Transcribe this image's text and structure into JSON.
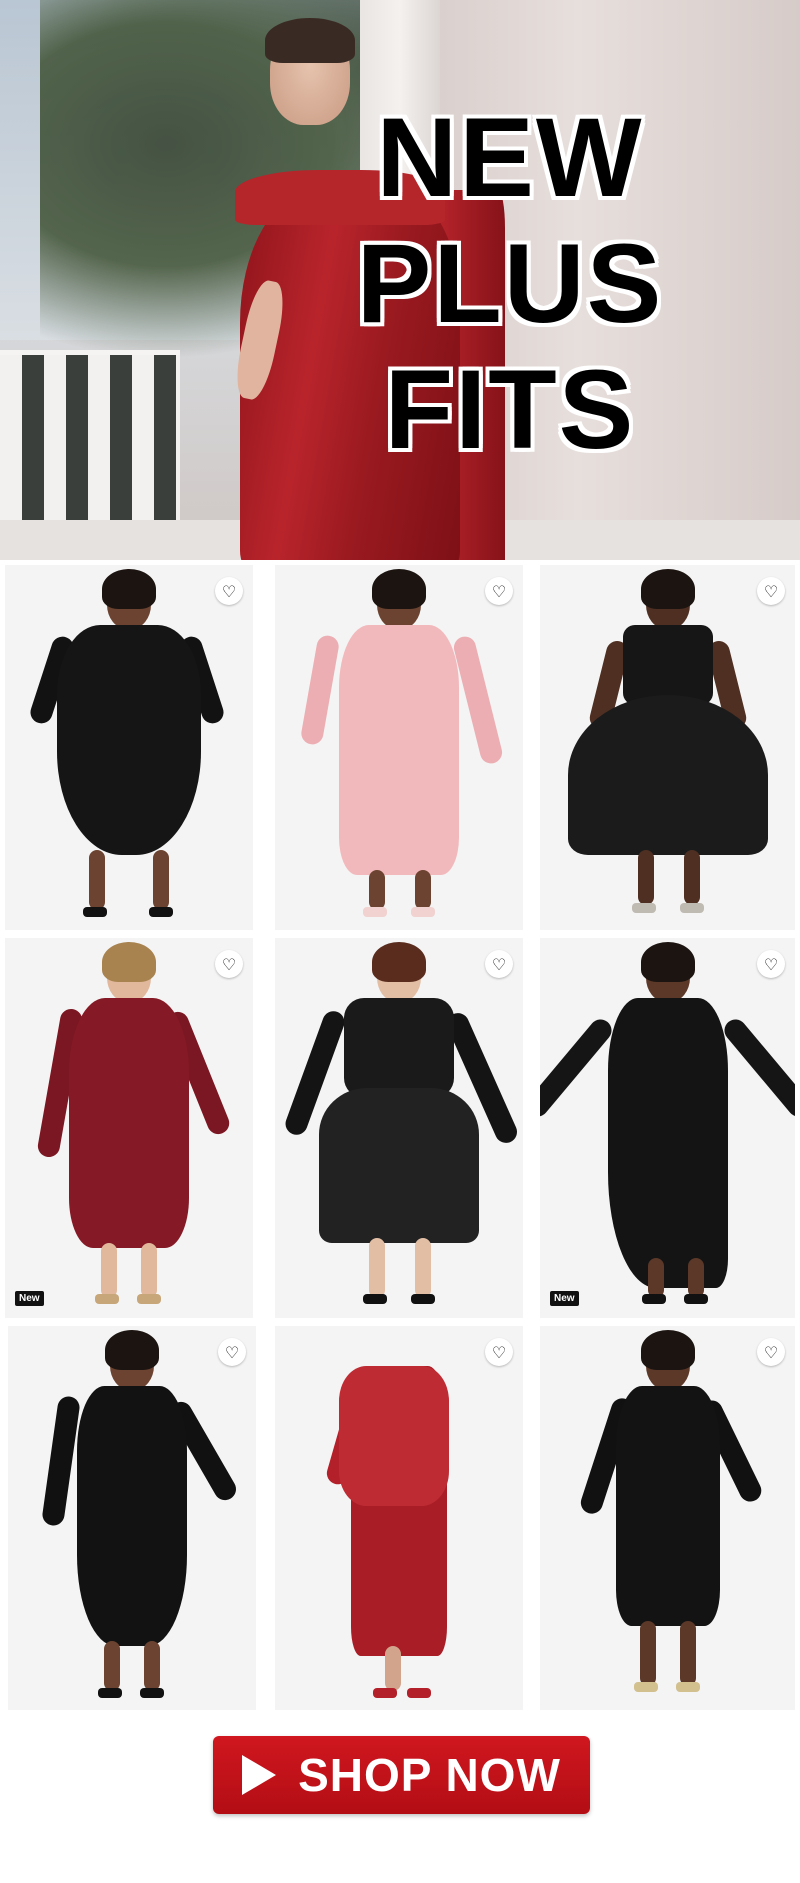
{
  "hero": {
    "headline": [
      "NEW",
      "PLUS",
      "FITS"
    ]
  },
  "products": [
    {
      "new_badge": "",
      "favorite_icon": "heart-outline-icon"
    },
    {
      "new_badge": "",
      "favorite_icon": "heart-outline-icon"
    },
    {
      "new_badge": "",
      "favorite_icon": "heart-outline-icon"
    },
    {
      "new_badge": "New",
      "favorite_icon": "heart-outline-icon"
    },
    {
      "new_badge": "",
      "favorite_icon": "heart-outline-icon"
    },
    {
      "new_badge": "New",
      "favorite_icon": "heart-outline-icon"
    },
    {
      "new_badge": "",
      "favorite_icon": "heart-outline-icon"
    },
    {
      "new_badge": "",
      "favorite_icon": "heart-outline-icon"
    },
    {
      "new_badge": "",
      "favorite_icon": "heart-outline-icon"
    }
  ],
  "cta": {
    "label": "SHOP NOW",
    "icon": "play-icon",
    "color": "#c4121a"
  },
  "colors": {
    "hero_dress": "#b5262b",
    "card_background": "#f4f4f4",
    "headline_text": "#000000",
    "headline_outline": "#ffffff"
  }
}
